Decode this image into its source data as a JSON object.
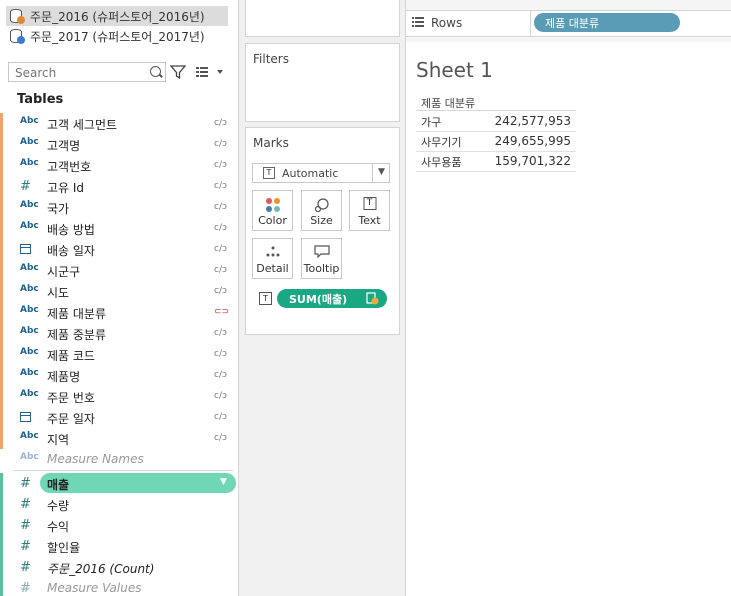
{
  "datasources": [
    {
      "label": "주문_2016 (슈퍼스토어_2016년)",
      "active": true,
      "badge_color": "#e0883a"
    },
    {
      "label": "주문_2017 (슈퍼스토어_2017년)",
      "active": false,
      "badge_color": "#3a7bd5"
    }
  ],
  "search": {
    "placeholder": "Search"
  },
  "tables_heading": "Tables",
  "dimension_fields": [
    {
      "type": "Abc",
      "name": "고객 세그먼트",
      "link": "c/ɔ",
      "accent": "#f0a36a"
    },
    {
      "type": "Abc",
      "name": "고객명",
      "link": "c/ɔ",
      "accent": "#f0a36a"
    },
    {
      "type": "Abc",
      "name": "고객번호",
      "link": "c/ɔ",
      "accent": "#f0a36a"
    },
    {
      "type": "#",
      "name": "고유 Id",
      "link": "c/ɔ",
      "accent": "#f0a36a"
    },
    {
      "type": "Abc",
      "name": "국가",
      "link": "c/ɔ",
      "accent": "#f0a36a"
    },
    {
      "type": "Abc",
      "name": "배송 방법",
      "link": "c/ɔ",
      "accent": "#f0a36a"
    },
    {
      "type": "cal",
      "name": "배송 일자",
      "link": "c/ɔ",
      "accent": "#f0a36a"
    },
    {
      "type": "Abc",
      "name": "시군구",
      "link": "c/ɔ",
      "accent": "#f0a36a"
    },
    {
      "type": "Abc",
      "name": "시도",
      "link": "c/ɔ",
      "accent": "#f0a36a"
    },
    {
      "type": "Abc",
      "name": "제품 대분류",
      "link": "⊂⊃",
      "accent": "#f0a36a"
    },
    {
      "type": "Abc",
      "name": "제품 중분류",
      "link": "c/ɔ",
      "accent": "#f0a36a"
    },
    {
      "type": "Abc",
      "name": "제품 코드",
      "link": "c/ɔ",
      "accent": "#f0a36a"
    },
    {
      "type": "Abc",
      "name": "제품명",
      "link": "c/ɔ",
      "accent": "#f0a36a"
    },
    {
      "type": "Abc",
      "name": "주문 번호",
      "link": "c/ɔ",
      "accent": "#f0a36a"
    },
    {
      "type": "cal",
      "name": "주문 일자",
      "link": "c/ɔ",
      "accent": "#f0a36a"
    },
    {
      "type": "Abc",
      "name": "지역",
      "link": "c/ɔ",
      "accent": "#f0a36a"
    },
    {
      "type": "Abc",
      "name": "Measure Names",
      "link": "",
      "accent": "#ffffff"
    }
  ],
  "measure_fields": [
    {
      "type": "#",
      "name": "매출"
    },
    {
      "type": "#",
      "name": "수량"
    },
    {
      "type": "#",
      "name": "수익"
    },
    {
      "type": "#",
      "name": "할인율"
    },
    {
      "type": "#",
      "name": "주문_2016 (Count)"
    },
    {
      "type": "#",
      "name": "Measure Values"
    }
  ],
  "shelves": {
    "filters_title": "Filters",
    "marks_title": "Marks",
    "marks_type": "Automatic",
    "mark_buttons": [
      "Color",
      "Size",
      "Text",
      "Detail",
      "Tooltip"
    ],
    "text_pill": "SUM(매출)"
  },
  "rows": {
    "label": "Rows",
    "pill": "제품 대분류"
  },
  "sheet": {
    "title": "Sheet 1",
    "header": "제품 대분류",
    "rows": [
      {
        "category": "가구",
        "value": "242,577,953"
      },
      {
        "category": "사무기기",
        "value": "249,655,995"
      },
      {
        "category": "사무용품",
        "value": "159,701,322"
      }
    ]
  },
  "colors": {
    "measure_accent": "#5bbf9e",
    "pill_green": "#1aa783",
    "pill_blue": "#5a9bb5",
    "dimension_accent": "#f0a36a"
  }
}
